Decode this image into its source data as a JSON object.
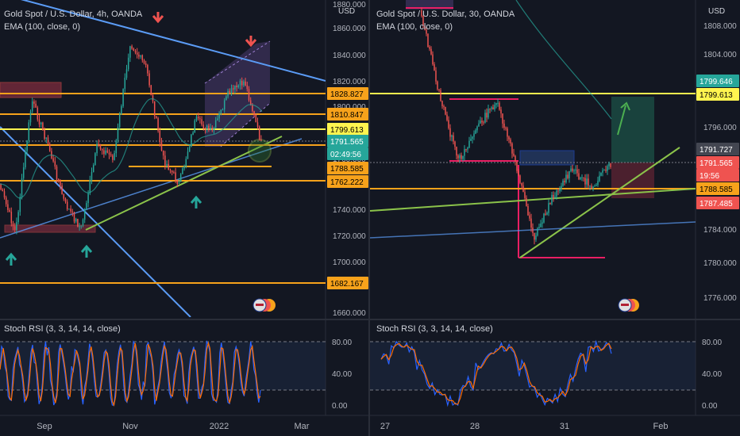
{
  "left_panel": {
    "title": "Gold Spot / U.S. Dollar, 4h, OANDA",
    "indicator": "EMA (100, close, 0)",
    "currency": "USD",
    "price_ticks": [
      "1880.000",
      "1860.000",
      "1840.000",
      "1820.000",
      "1800.000",
      "1780.000",
      "1760.000",
      "1740.000",
      "1720.000",
      "1700.000",
      "1660.000"
    ],
    "price_tags": [
      {
        "label": "1828.827",
        "color": "#f7a21b",
        "text_color": "#000000"
      },
      {
        "label": "1810.847",
        "color": "#f7a21b",
        "text_color": "#000000"
      },
      {
        "label": "1799.613",
        "color": "#fff44f",
        "text_color": "#000000"
      },
      {
        "label": "1791.565",
        "color": "#26a69a",
        "text_color": "#ffffff"
      },
      {
        "label": "02:49:56",
        "color": "#26a69a",
        "text_color": "#ffffff"
      },
      {
        "label": "1788.585",
        "color": "#f7a21b",
        "text_color": "#000000"
      },
      {
        "label": "1762.222",
        "color": "#f7a21b",
        "text_color": "#000000"
      },
      {
        "label": "1682.167",
        "color": "#f7a21b",
        "text_color": "#000000"
      }
    ],
    "stoch_label": "Stoch RSI (3, 3, 14, 14, close)",
    "stoch_ticks": [
      "80.00",
      "40.00",
      "0.00"
    ],
    "time_ticks": [
      "Sep",
      "Nov",
      "2022",
      "Mar"
    ]
  },
  "right_panel": {
    "title": "Gold Spot / U.S. Dollar, 30, OANDA",
    "indicator": "EMA (100, close, 0)",
    "currency": "USD",
    "price_ticks": [
      "1808.000",
      "1804.000",
      "1796.000",
      "1784.000",
      "1780.000",
      "1776.000"
    ],
    "price_tags": [
      {
        "label": "1799.646",
        "color": "#26a69a",
        "text_color": "#ffffff"
      },
      {
        "label": "1799.613",
        "color": "#fff44f",
        "text_color": "#000000"
      },
      {
        "label": "1791.727",
        "color": "#434651",
        "text_color": "#ffffff"
      },
      {
        "label": "1791.565",
        "color": "#ef5350",
        "text_color": "#ffffff"
      },
      {
        "label": "19:56",
        "color": "#ef5350",
        "text_color": "#ffffff"
      },
      {
        "label": "1788.585",
        "color": "#f7a21b",
        "text_color": "#000000"
      },
      {
        "label": "1787.485",
        "color": "#ef5350",
        "text_color": "#ffffff"
      }
    ],
    "stoch_label": "Stoch RSI (3, 3, 14, 14, close)",
    "stoch_ticks": [
      "80.00",
      "40.00",
      "0.00"
    ],
    "time_ticks": [
      "27",
      "28",
      "31",
      "Feb"
    ]
  },
  "colors": {
    "background": "#131722",
    "up": "#26a69a",
    "down": "#ef5350",
    "orange_level": "#f7a21b",
    "yellow_level": "#fff44f",
    "trendline_blue": "#5b9cf6",
    "trendline_green": "#8bc34a",
    "stoch_k": "#2962ff",
    "stoch_d": "#ff6d00"
  },
  "chart_data": [
    {
      "type": "candlestick",
      "title": "Gold Spot / U.S. Dollar, 4h, OANDA",
      "ylabel": "USD",
      "ylim": [
        1660,
        1900
      ],
      "levels": [
        1828.827,
        1810.847,
        1799.613,
        1788.585,
        1762.222,
        1682.167
      ],
      "last_price": 1791.565,
      "close_path": [
        {
          "x": "Aug",
          "y": 1760
        },
        {
          "x": "Aug",
          "y": 1722
        },
        {
          "x": "Sep",
          "y": 1825
        },
        {
          "x": "Sep",
          "y": 1790
        },
        {
          "x": "Sep",
          "y": 1745
        },
        {
          "x": "Oct",
          "y": 1725
        },
        {
          "x": "Oct",
          "y": 1790
        },
        {
          "x": "Nov",
          "y": 1780
        },
        {
          "x": "Nov",
          "y": 1870
        },
        {
          "x": "Nov",
          "y": 1850
        },
        {
          "x": "Dec",
          "y": 1780
        },
        {
          "x": "Dec",
          "y": 1760
        },
        {
          "x": "Dec",
          "y": 1810
        },
        {
          "x": "2022",
          "y": 1800
        },
        {
          "x": "2022",
          "y": 1830
        },
        {
          "x": "Jan",
          "y": 1840
        },
        {
          "x": "Jan",
          "y": 1791.565
        }
      ]
    },
    {
      "type": "candlestick",
      "title": "Gold Spot / U.S. Dollar, 30, OANDA",
      "ylabel": "USD",
      "ylim": [
        1774,
        1810
      ],
      "levels": [
        1799.613,
        1788.585
      ],
      "last_price": 1791.565,
      "close_path": [
        {
          "x": "27",
          "y": 1810
        },
        {
          "x": "27",
          "y": 1800
        },
        {
          "x": "28",
          "y": 1792
        },
        {
          "x": "28",
          "y": 1796
        },
        {
          "x": "28",
          "y": 1799
        },
        {
          "x": "28",
          "y": 1792
        },
        {
          "x": "31",
          "y": 1783
        },
        {
          "x": "31",
          "y": 1788
        },
        {
          "x": "31",
          "y": 1791
        },
        {
          "x": "31",
          "y": 1789
        },
        {
          "x": "31",
          "y": 1791.565
        }
      ]
    }
  ]
}
